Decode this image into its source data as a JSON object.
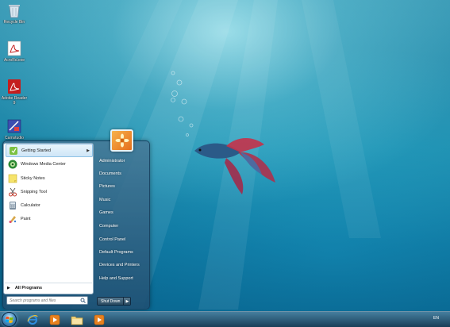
{
  "desktop": {
    "icons": [
      {
        "label": "Recycle Bin",
        "icon": "recycle-bin-icon"
      },
      {
        "label": "AcroRd.exe",
        "icon": "acrobat-icon"
      },
      {
        "label": "Adobe Reader 9",
        "icon": "adobe-reader-icon"
      },
      {
        "label": "Camstudio",
        "icon": "camstudio-icon"
      }
    ]
  },
  "start_menu": {
    "programs": [
      {
        "label": "Getting Started",
        "icon": "getting-started-icon",
        "has_submenu": true
      },
      {
        "label": "Windows Media Center",
        "icon": "media-center-icon"
      },
      {
        "label": "Sticky Notes",
        "icon": "sticky-notes-icon"
      },
      {
        "label": "Snipping Tool",
        "icon": "snipping-tool-icon"
      },
      {
        "label": "Calculator",
        "icon": "calculator-icon"
      },
      {
        "label": "Paint",
        "icon": "paint-icon"
      }
    ],
    "all_programs_label": "All Programs",
    "search_placeholder": "Search programs and files",
    "right_items": [
      {
        "label": "Administrator"
      },
      {
        "label": "Documents"
      },
      {
        "label": "Pictures"
      },
      {
        "label": "Music"
      },
      {
        "label": "Games"
      },
      {
        "label": "Computer"
      },
      {
        "label": "Control Panel"
      },
      {
        "label": "Default Programs"
      },
      {
        "label": "Devices and Printers"
      },
      {
        "label": "Help and Support"
      }
    ],
    "shutdown_label": "Shut Down"
  },
  "taskbar": {
    "pinned": [
      {
        "icon": "internet-explorer-icon"
      },
      {
        "icon": "media-player-icon"
      },
      {
        "icon": "file-explorer-icon"
      },
      {
        "icon": "media-player-icon"
      }
    ],
    "language": "EN"
  },
  "colors": {
    "accent": "#1283ad",
    "highlight": "#cfe6f7"
  }
}
